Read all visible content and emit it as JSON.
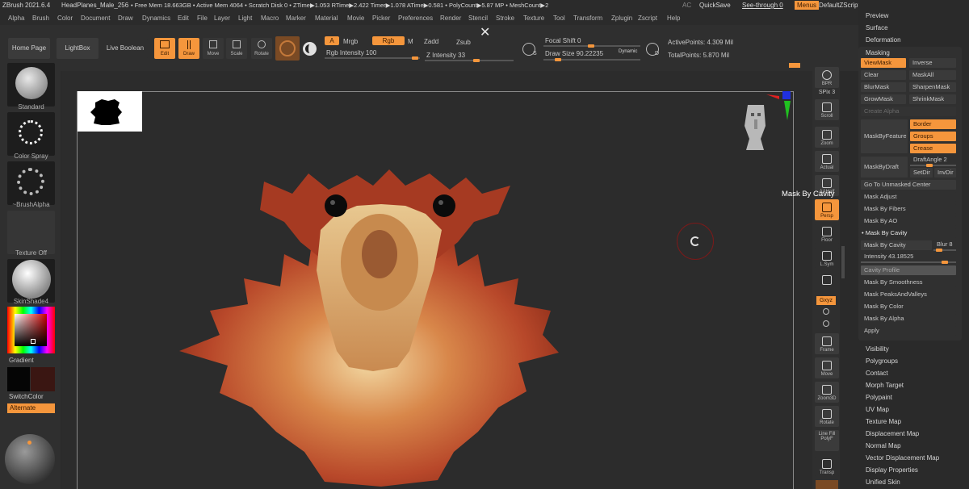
{
  "titlebar": {
    "app": "ZBrush 2021.6.4",
    "doc": "HeadPlanes_Male_256",
    "stats": "• Free Mem 18.663GB • Active Mem 4064 • Scratch Disk 0 • ZTime▶1.053 RTime▶2.422 Timer▶1.078 ATime▶0.581 • PolyCount▶5.87 MP • MeshCount▶2",
    "ac": "AC",
    "quicksave": "QuickSave",
    "seethrough": "See-through 0",
    "menus": "Menus",
    "script": "DefaultZScript"
  },
  "menubar": [
    "Alpha",
    "Brush",
    "Color",
    "Document",
    "Draw",
    "Dynamics",
    "Edit",
    "File",
    "Layer",
    "Light",
    "Macro",
    "Marker",
    "Material",
    "Movie",
    "Picker",
    "Preferences",
    "Render",
    "Stencil",
    "Stroke",
    "Texture",
    "Tool",
    "Transform",
    "Zplugin",
    "Zscript",
    "Help"
  ],
  "shelf": {
    "home": "Home Page",
    "lightbox": "LightBox",
    "livebool": "Live Boolean",
    "edit": "Edit",
    "draw": "Draw",
    "move": "Move",
    "scale": "Scale",
    "rotate": "Rotate",
    "a": "A",
    "mrgb": "Mrgb",
    "rgb": "Rgb",
    "m": "M",
    "zadd": "Zadd",
    "zsub": "Zsub",
    "rgb_intensity": "Rgb Intensity 100",
    "z_intensity": "Z Intensity 33",
    "focal": "Focal Shift 0",
    "drawsize": "Draw Size 90.22235",
    "dynamic": "Dynamic",
    "s": "S",
    "d": "D",
    "active_points": "ActivePoints: 4.309 Mil",
    "total_points": "TotalPoints: 5.870 Mil"
  },
  "left": {
    "brush": "Standard",
    "stroke": "Color Spray",
    "alpha": "~BrushAlpha",
    "texture": "Texture Off",
    "material": "SkinShade4",
    "gradient": "Gradient",
    "switch": "SwitchColor",
    "alternate": "Alternate"
  },
  "rshelf": [
    "BPR",
    "SPix 3",
    "Scroll",
    "Zoom",
    "Actual",
    "AAHalf",
    "Persp",
    "Floor",
    "L.Sym",
    "",
    "Gxyz",
    "",
    "",
    "Frame",
    "Move",
    "Zoom3D",
    "Rotate",
    "Line Fill PolyF",
    "Transp"
  ],
  "tray": {
    "preview": "Preview",
    "surface": "Surface",
    "deformation": "Deformation",
    "masking": "Masking",
    "viewmask": "ViewMask",
    "inverse": "Inverse",
    "clear": "Clear",
    "maskall": "MaskAll",
    "blurmask": "BlurMask",
    "sharpenmask": "SharpenMask",
    "growmask": "GrowMask",
    "shrinkmask": "ShrinkMask",
    "createalpha": "Create Alpha",
    "maskbyfeature": "MaskByFeature",
    "border": "Border",
    "groups": "Groups",
    "crease": "Crease",
    "draftangle": "DraftAngle 2",
    "maskbydraft": "MaskByDraft",
    "setdir": "SetDir",
    "invdir": "InvDir",
    "gotounmasked": "Go To Unmasked Center",
    "maskadjust": "Mask Adjust",
    "maskbyfibers": "Mask By Fibers",
    "maskbyao": "Mask By AO",
    "maskbycavity_hdr": "• Mask By Cavity",
    "maskbycavity": "Mask By Cavity",
    "blur": "Blur 8",
    "intensity": "Intensity 43.18525",
    "cavityprofile": "Cavity Profile",
    "maskbysmoothness": "Mask By Smoothness",
    "maskpeaks": "Mask PeaksAndValleys",
    "maskbycolor": "Mask By Color",
    "maskbyalpha": "Mask By Alpha",
    "apply": "Apply",
    "subpalettes": [
      "Visibility",
      "Polygroups",
      "Contact",
      "Morph Target",
      "Polypaint",
      "UV Map",
      "Texture Map",
      "Displacement Map",
      "Normal Map",
      "Vector Displacement Map",
      "Display Properties",
      "Unified Skin"
    ]
  },
  "tooltip": "Mask By Cavity",
  "colors": {
    "accent": "#f5963c",
    "bg": "#2a2a2a",
    "creature": "#b8482a"
  }
}
